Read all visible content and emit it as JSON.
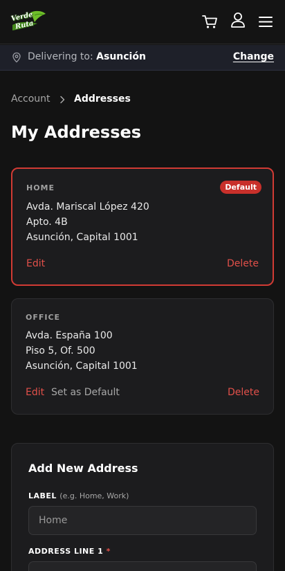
{
  "header": {
    "logo_line1": "Verde",
    "logo_line2": "Ruta",
    "icons": [
      "cart-icon",
      "user-icon",
      "menu-icon"
    ]
  },
  "delivery": {
    "prefix": "Delivering to: ",
    "city": "Asunción",
    "change_label": "Change"
  },
  "breadcrumb": {
    "account": "Account",
    "current": "Addresses"
  },
  "page_title": "My Addresses",
  "addresses": [
    {
      "label": "HOME",
      "is_default": true,
      "badge": "Default",
      "lines": [
        "Avda. Mariscal López 420",
        "Apto. 4B",
        "Asunción, Capital 1001"
      ],
      "edit_label": "Edit",
      "delete_label": "Delete"
    },
    {
      "label": "OFFICE",
      "is_default": false,
      "lines": [
        "Avda. España 100",
        "Piso 5, Of. 500",
        "Asunción, Capital 1001"
      ],
      "edit_label": "Edit",
      "set_default_label": "Set as Default",
      "delete_label": "Delete"
    }
  ],
  "form": {
    "title": "Add New Address",
    "label_field": {
      "label": "LABEL",
      "hint": "(e.g. Home, Work)",
      "placeholder": "Home"
    },
    "address1_field": {
      "label": "ADDRESS LINE 1",
      "required_mark": "*"
    }
  },
  "colors": {
    "accent": "#e2504a",
    "default_border": "#d23b34",
    "badge": "#c8302b",
    "background": "#131313",
    "card": "#1c1c1e",
    "brand_green": "#6fbf2a"
  }
}
